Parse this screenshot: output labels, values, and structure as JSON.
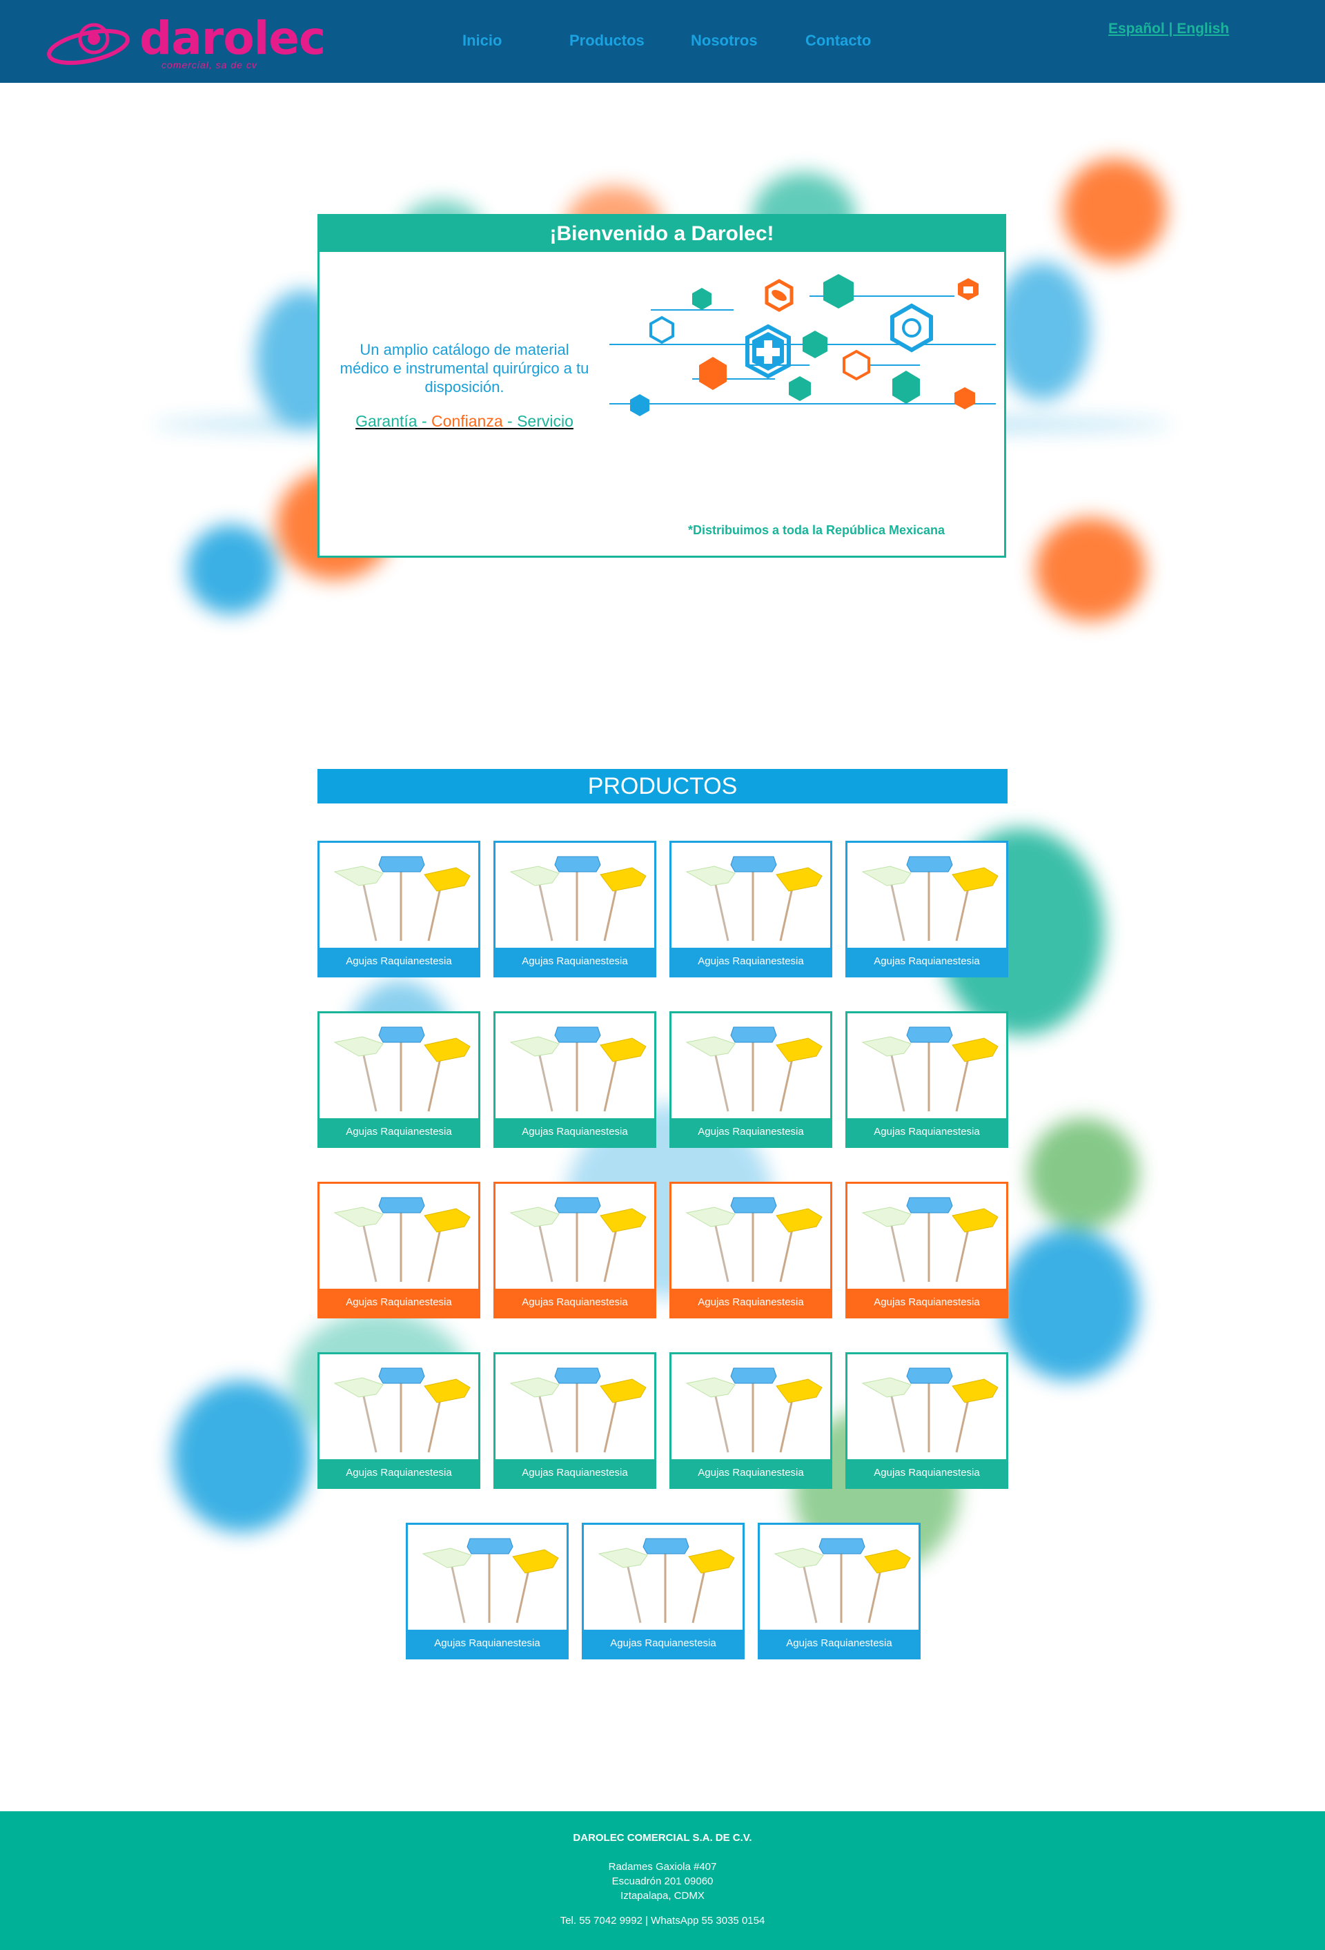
{
  "header": {
    "logo_text": "darolec",
    "logo_sub": "comercial, sa de cv",
    "nav": [
      "Inicio",
      "Productos",
      "Nosotros",
      "Contacto"
    ],
    "lang_es": "Español",
    "lang_sep": " | ",
    "lang_en": "English"
  },
  "welcome": {
    "title": "¡Bienvenido a Darolec!",
    "text": "Un amplio catálogo de material médico e instrumental quirúrgico a tu disposición.",
    "tagline": [
      "Garantía",
      " - ",
      "Confianza",
      " - ",
      "Servicio"
    ],
    "note": "*Distribuimos a toda la República Mexicana"
  },
  "products": {
    "title": "PRODUCTOS",
    "items": [
      {
        "label": "Agujas Raquianestesia",
        "color": "blue"
      },
      {
        "label": "Agujas Raquianestesia",
        "color": "blue"
      },
      {
        "label": "Agujas Raquianestesia",
        "color": "blue"
      },
      {
        "label": "Agujas Raquianestesia",
        "color": "blue"
      },
      {
        "label": "Agujas Raquianestesia",
        "color": "teal"
      },
      {
        "label": "Agujas Raquianestesia",
        "color": "teal"
      },
      {
        "label": "Agujas Raquianestesia",
        "color": "teal"
      },
      {
        "label": "Agujas Raquianestesia",
        "color": "teal"
      },
      {
        "label": "Agujas Raquianestesia",
        "color": "orange"
      },
      {
        "label": "Agujas Raquianestesia",
        "color": "orange"
      },
      {
        "label": "Agujas Raquianestesia",
        "color": "orange"
      },
      {
        "label": "Agujas Raquianestesia",
        "color": "orange"
      },
      {
        "label": "Agujas Raquianestesia",
        "color": "teal"
      },
      {
        "label": "Agujas Raquianestesia",
        "color": "teal"
      },
      {
        "label": "Agujas Raquianestesia",
        "color": "teal"
      },
      {
        "label": "Agujas Raquianestesia",
        "color": "teal"
      },
      {
        "label": "Agujas Raquianestesia",
        "color": "blue"
      },
      {
        "label": "Agujas Raquianestesia",
        "color": "blue"
      },
      {
        "label": "Agujas Raquianestesia",
        "color": "blue"
      }
    ]
  },
  "footer": {
    "company": "DAROLEC COMERCIAL S.A. DE C.V.",
    "address": [
      "Radames Gaxiola #407",
      "Escuadrón 201 09060",
      "Iztapalapa, CDMX"
    ],
    "phone": "Tel. 55 7042 9992 | WhatsApp 55 3035 0154"
  },
  "colors": {
    "header_bg": "#0b5a8c",
    "brand_pink": "#e41d8a",
    "blue": "#1aa3e0",
    "teal": "#19b49a",
    "orange": "#ff6a1a",
    "footer_bg": "#00b197"
  }
}
